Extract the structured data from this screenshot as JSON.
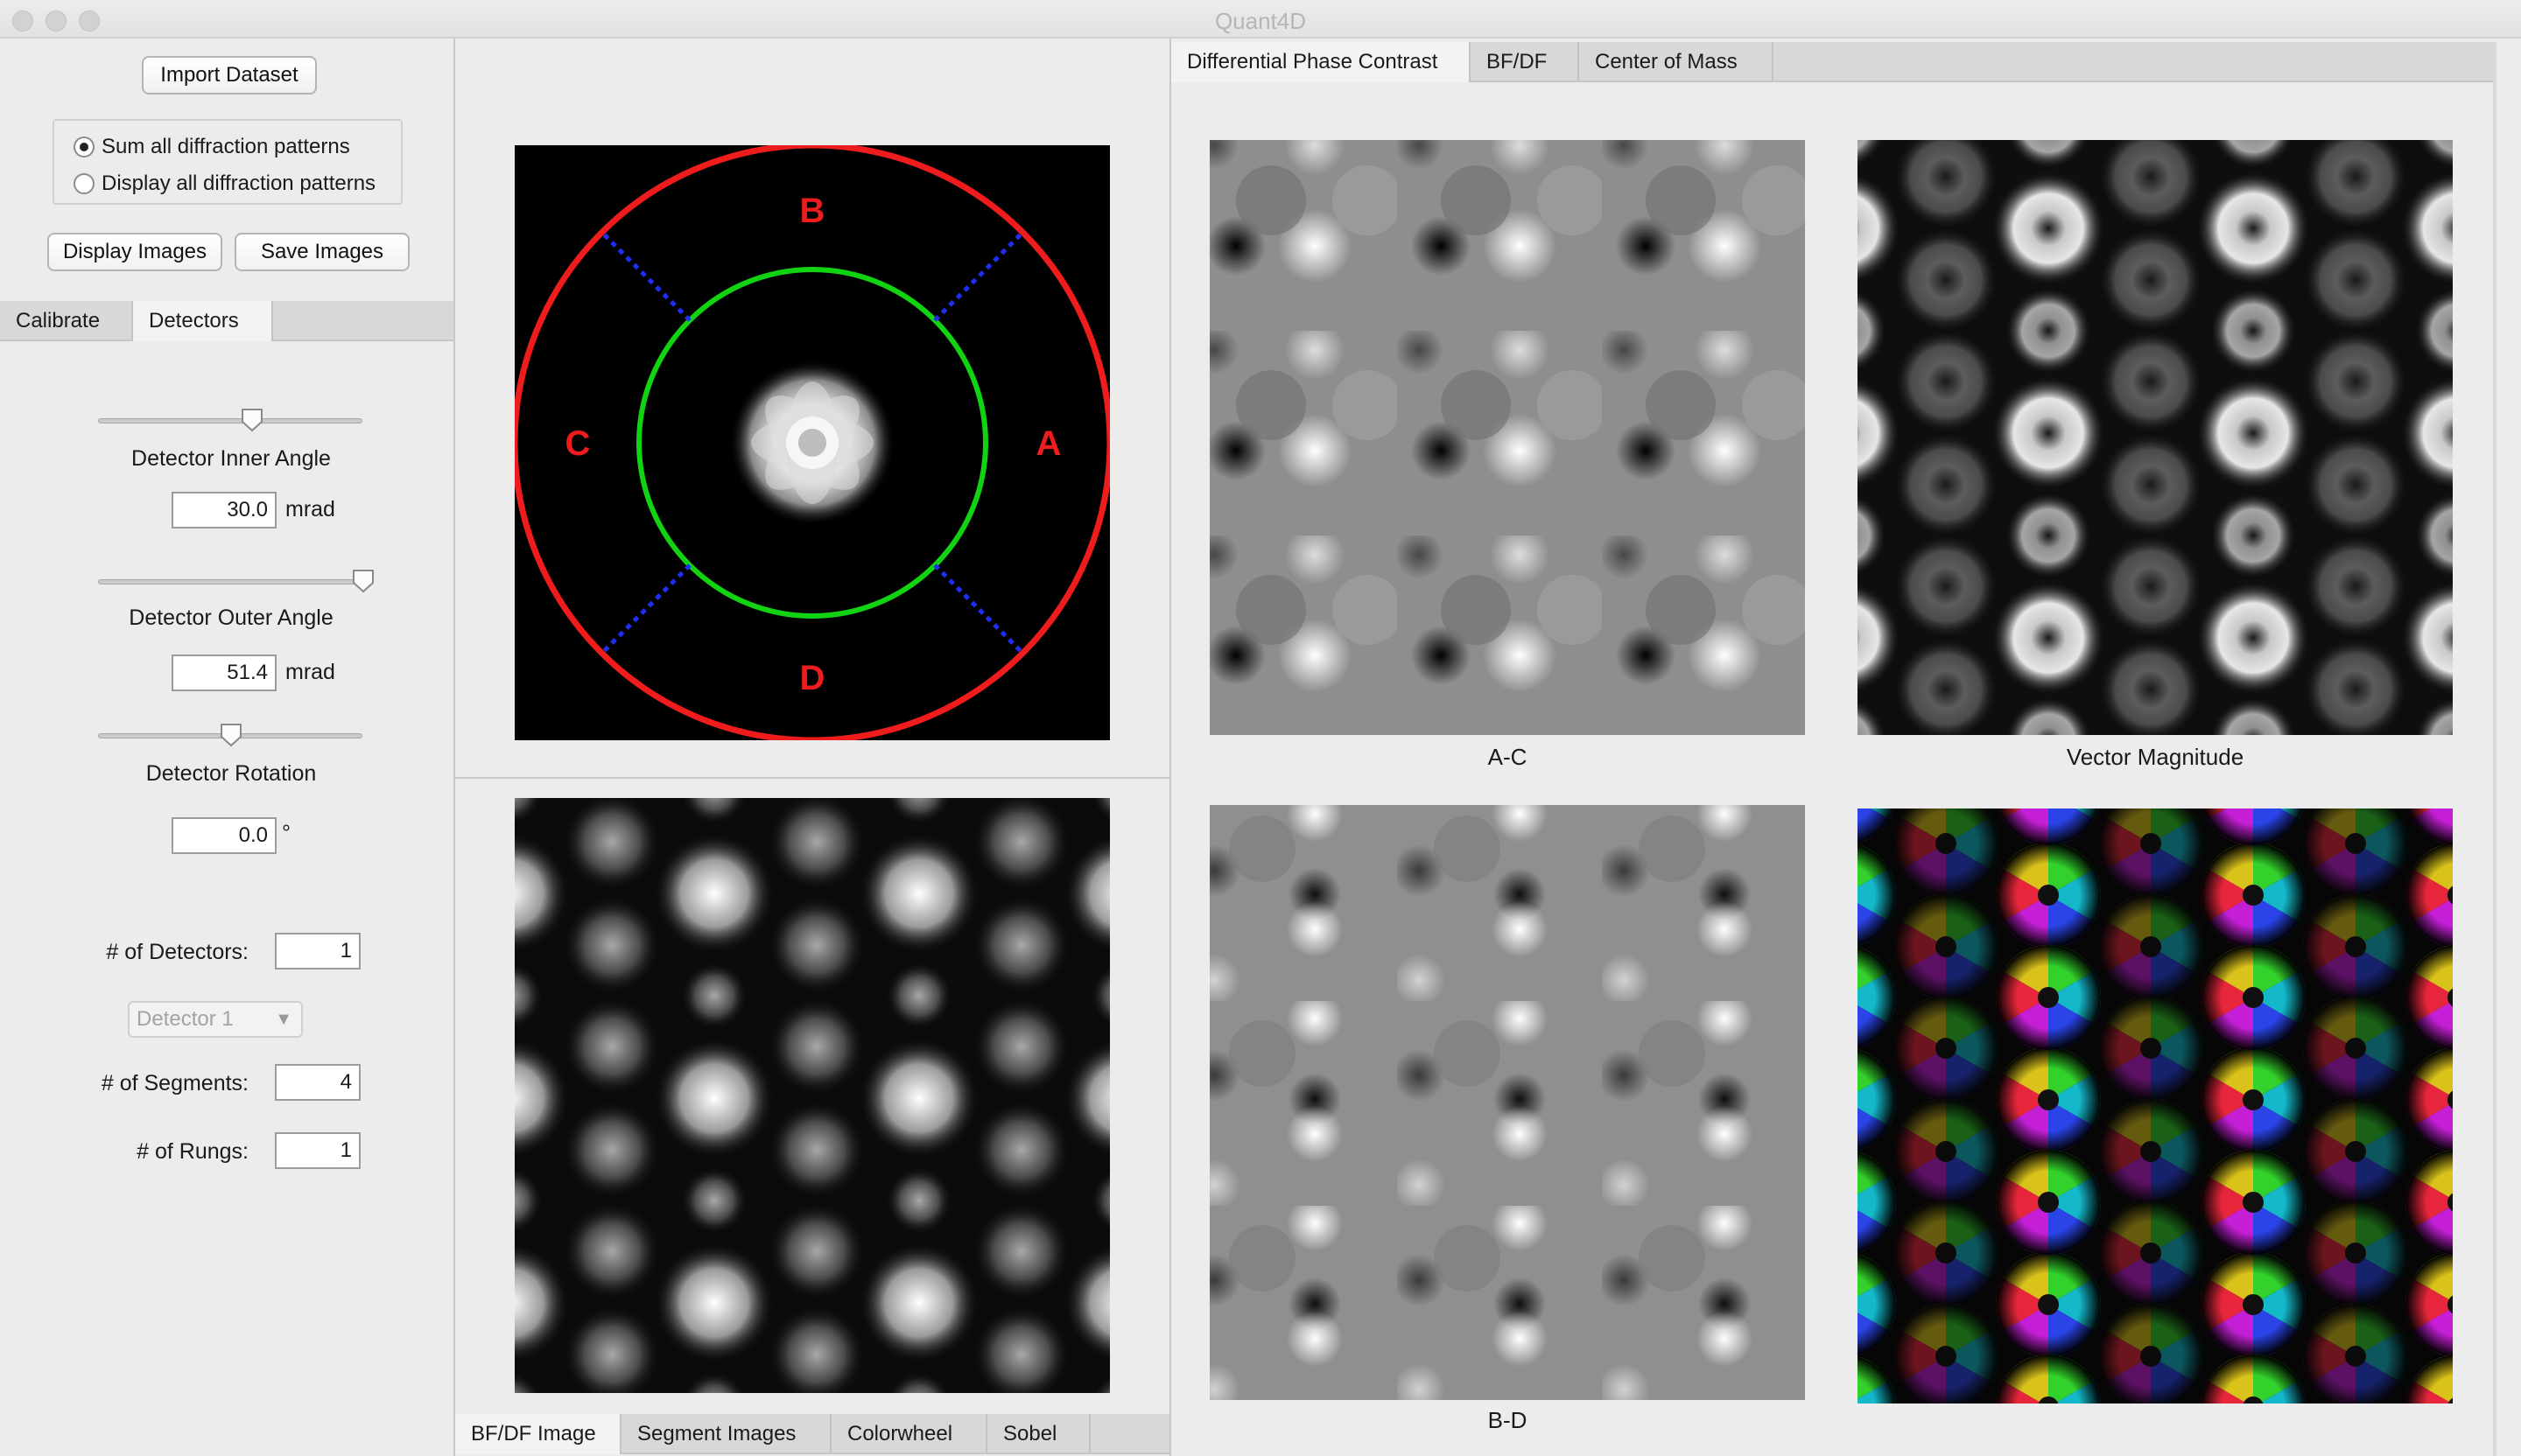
{
  "window": {
    "title": "Quant4D"
  },
  "left_panel": {
    "import_button": "Import Dataset",
    "radio_options": [
      "Sum all diffraction patterns",
      "Display all diffraction patterns"
    ],
    "display_images_button": "Display Images",
    "save_images_button": "Save Images",
    "tabs": [
      "Calibrate",
      "Detectors"
    ],
    "active_tab": "Detectors",
    "inner_angle": {
      "label": "Detector Inner Angle",
      "value": "30.0",
      "unit": "mrad",
      "slider_fraction": 0.58
    },
    "outer_angle": {
      "label": "Detector Outer Angle",
      "value": "51.4",
      "unit": "mrad",
      "slider_fraction": 0.99
    },
    "rotation": {
      "label": "Detector Rotation",
      "value": "0.0",
      "unit": "°",
      "slider_fraction": 0.5
    },
    "num_detectors": {
      "label": "# of Detectors:",
      "value": "1"
    },
    "detector_select": {
      "selected": "Detector 1"
    },
    "num_segments": {
      "label": "# of Segments:",
      "value": "4"
    },
    "num_rungs": {
      "label": "# of Rungs:",
      "value": "1"
    }
  },
  "middle_panel": {
    "segment_labels": {
      "a": "A",
      "b": "B",
      "c": "C",
      "d": "D"
    },
    "bottom_tabs": [
      "BF/DF Image",
      "Segment Images",
      "Colorwheel",
      "Sobel"
    ],
    "active_bottom_tab": "BF/DF Image"
  },
  "right_panel": {
    "tabs": [
      "Differential Phase Contrast",
      "BF/DF",
      "Center of Mass"
    ],
    "active_tab": "Differential Phase Contrast",
    "captions": {
      "top_left": "A-C",
      "top_right": "Vector Magnitude",
      "bottom_left": "B-D",
      "bottom_right": ""
    }
  },
  "colors": {
    "outer_ring": "#ee1c1c",
    "inner_ring": "#12d312",
    "divider": "#1f2ff0",
    "segment_label": "#ee1c1c"
  },
  "icons": {
    "window_controls": [
      "close-icon",
      "minimize-icon",
      "zoom-icon"
    ],
    "select_arrow": "chevron-down-icon",
    "slider_thumb": "slider-thumb-icon"
  }
}
